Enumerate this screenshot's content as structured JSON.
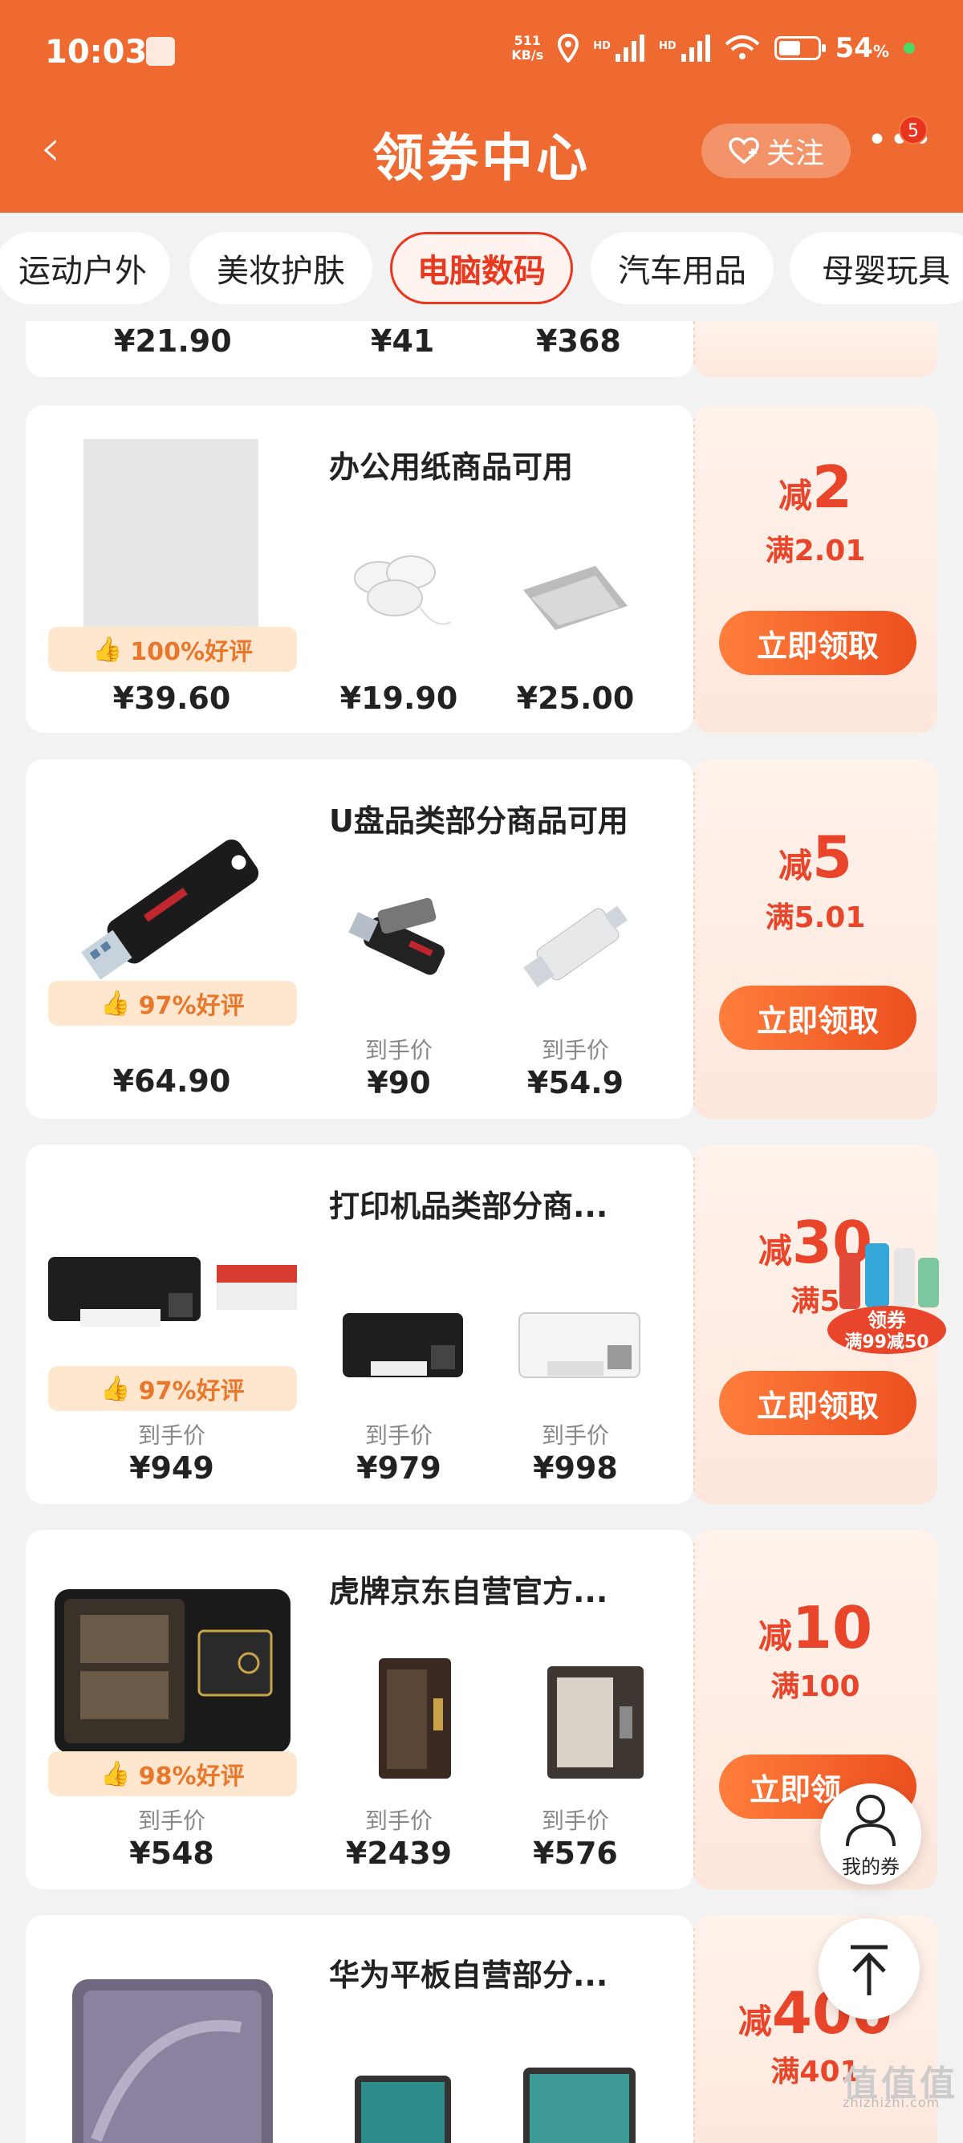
{
  "status": {
    "time": "10:03",
    "net_speed": "511\nKB/s",
    "battery_pct": "54",
    "battery_unit": "%",
    "hd1": "HD",
    "hd2": "HD"
  },
  "nav": {
    "back": "‹",
    "title": "领券中心",
    "follow_label": "关注",
    "more_badge": "5"
  },
  "tabs": [
    "运动户外",
    "美妆护肤",
    "电脑数码",
    "汽车用品",
    "母婴玩具"
  ],
  "top_partial": {
    "prices": [
      "¥21.90",
      "¥41",
      "¥368"
    ]
  },
  "coupons": [
    {
      "title": "办公用纸商品可用",
      "badge": "100%好评",
      "main_price_label": "",
      "main_price": "¥39.60",
      "thumbs": [
        {
          "label": "",
          "price": "¥19.90"
        },
        {
          "label": "",
          "price": "¥25.00"
        }
      ],
      "reduce_prefix": "减",
      "reduce_amount": "2",
      "condition": "满2.01",
      "button": "立即领取"
    },
    {
      "title": "U盘品类部分商品可用",
      "badge": "97%好评",
      "main_price_label": "",
      "main_price": "¥64.90",
      "thumbs": [
        {
          "label": "到手价",
          "price": "¥90"
        },
        {
          "label": "到手价",
          "price": "¥54.9"
        }
      ],
      "reduce_prefix": "减",
      "reduce_amount": "5",
      "condition": "满5.01",
      "button": "立即领取"
    },
    {
      "title": "打印机品类部分商...",
      "badge": "97%好评",
      "main_price_label": "到手价",
      "main_price": "¥949",
      "thumbs": [
        {
          "label": "到手价",
          "price": "¥979"
        },
        {
          "label": "到手价",
          "price": "¥998"
        }
      ],
      "reduce_prefix": "减",
      "reduce_amount": "30",
      "condition": "满5",
      "button": "立即领取"
    },
    {
      "title": "虎牌京东自营官方...",
      "badge": "98%好评",
      "main_price_label": "到手价",
      "main_price": "¥548",
      "thumbs": [
        {
          "label": "到手价",
          "price": "¥2439"
        },
        {
          "label": "到手价",
          "price": "¥576"
        }
      ],
      "reduce_prefix": "减",
      "reduce_amount": "10",
      "condition": "满100",
      "button": "立即领"
    },
    {
      "title": "华为平板自营部分...",
      "badge": "",
      "main_price_label": "",
      "main_price": "",
      "thumbs": [],
      "reduce_prefix": "减",
      "reduce_amount": "400",
      "condition": "满401",
      "button": ""
    }
  ],
  "promo": {
    "line1": "领券",
    "line2": "满99减50"
  },
  "floating": {
    "my_coupons": "我的券"
  },
  "watermark": {
    "big": "值值值",
    "small": "zhizhizhi.com"
  }
}
